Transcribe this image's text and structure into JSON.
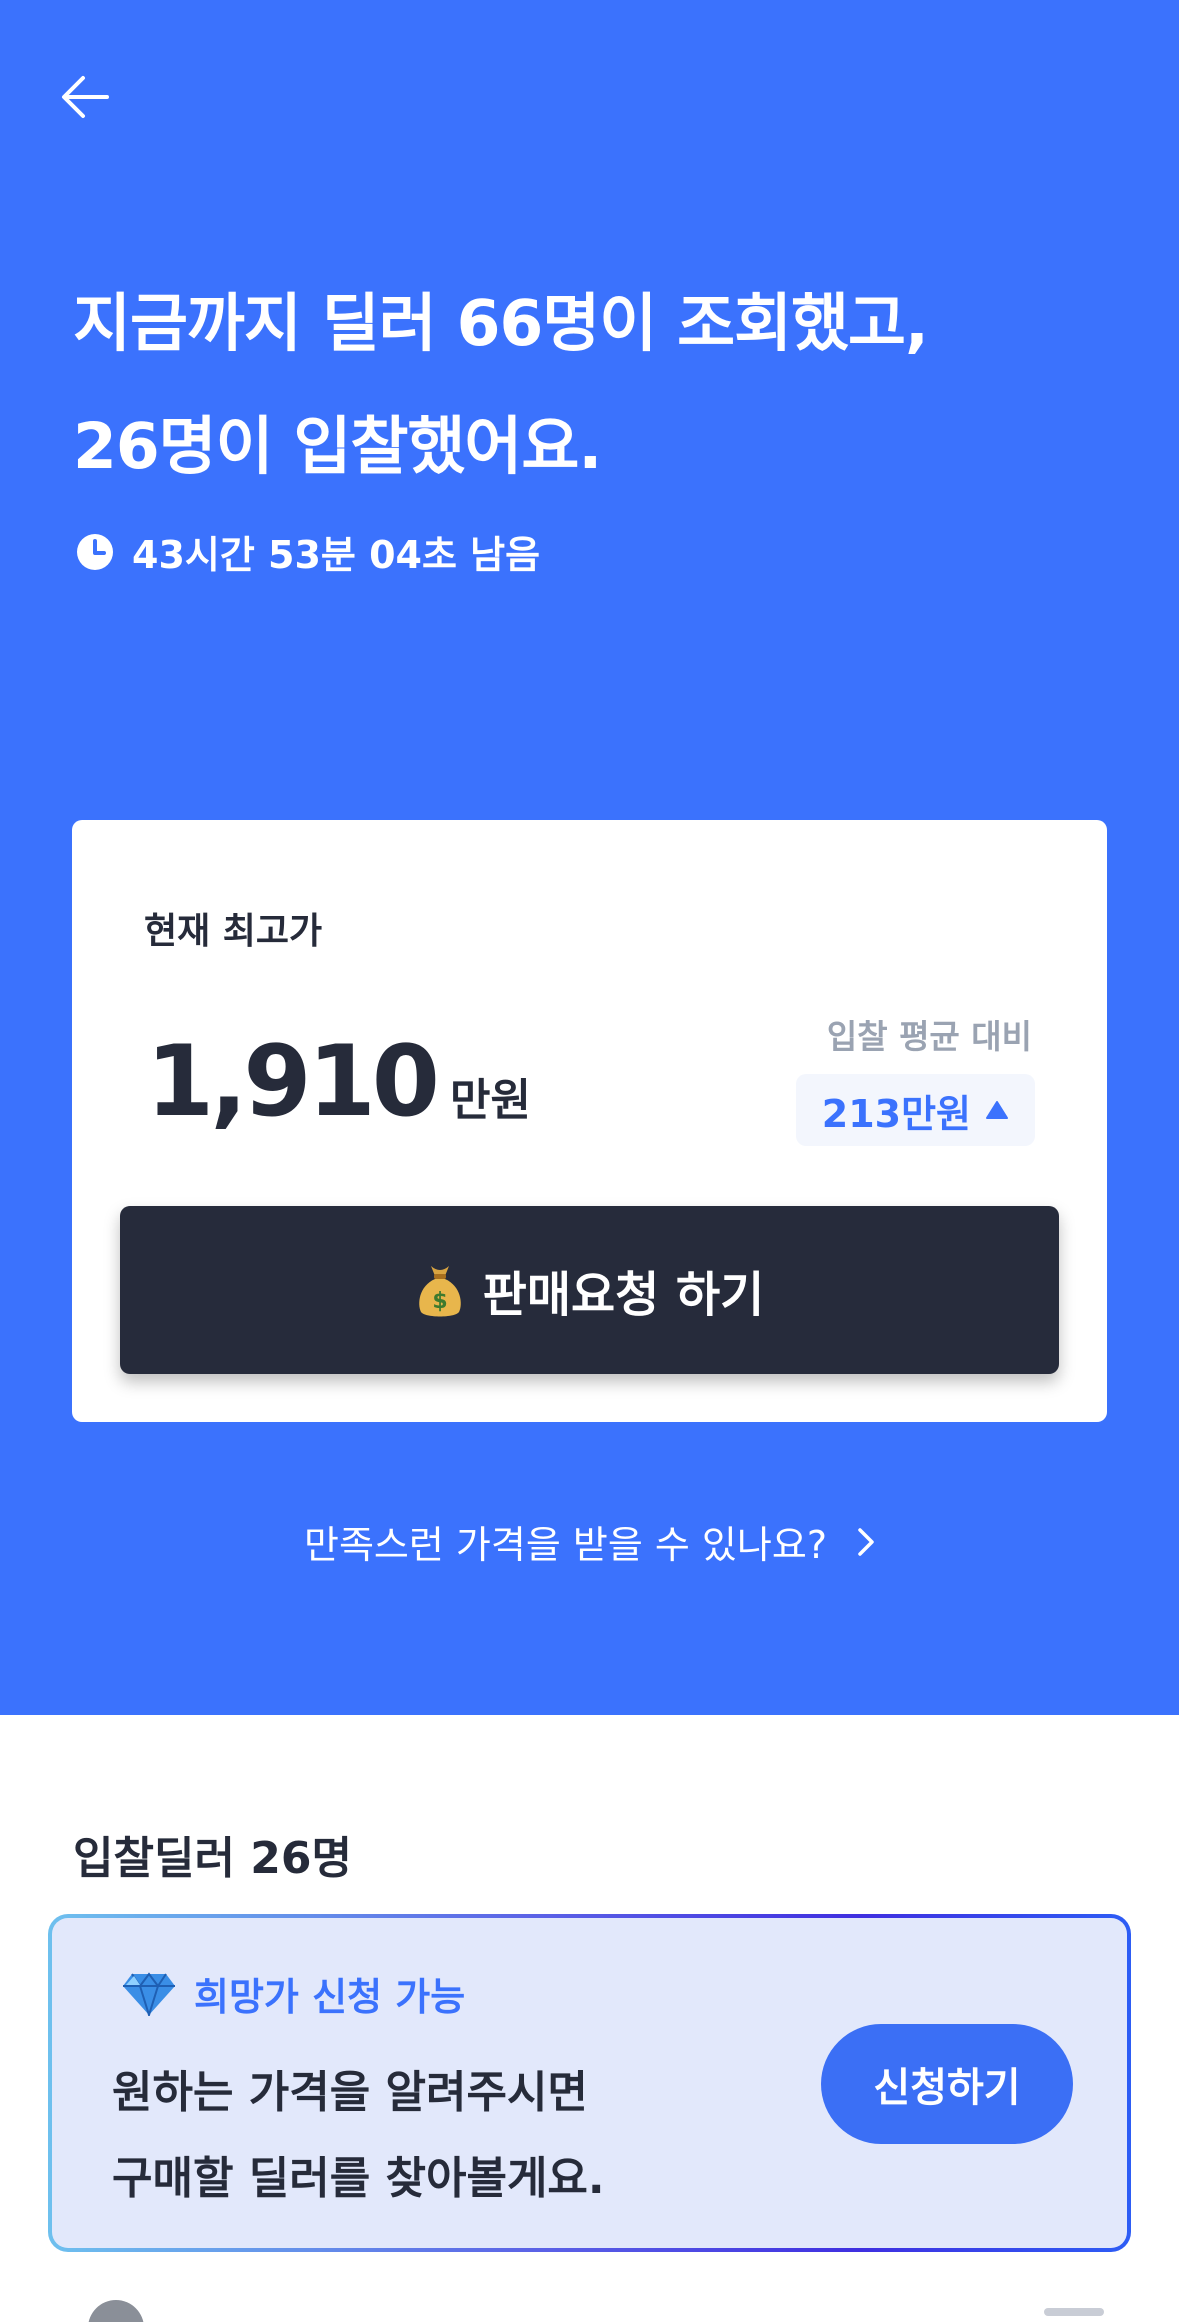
{
  "header": {
    "back_icon": "arrow-left-icon"
  },
  "hero": {
    "headline_line1": "지금까지 딜러 66명이 조회했고,",
    "headline_line2": "26명이 입찰했어요.",
    "timer_icon": "clock-icon",
    "timer_text": "43시간 53분 04초 남음",
    "bg_color": "#3b72fd"
  },
  "price_card": {
    "label": "현재 최고가",
    "price_value": "1,910",
    "price_unit": "만원",
    "avg_label": "입찰 평균 대비",
    "avg_diff": "213만원",
    "avg_trend_icon": "triangle-up-icon",
    "sell_icon": "money-bag-icon",
    "sell_label": "판매요청 하기"
  },
  "satisfy_link": {
    "label": "만족스런 가격을 받을 수 있나요?",
    "icon": "chevron-right-icon"
  },
  "bidders": {
    "title": "입찰딜러 26명"
  },
  "wish_price": {
    "tag_icon": "gem-icon",
    "tag_label": "희망가 신청 가능",
    "desc_line1": "원하는 가격을 알려주시면",
    "desc_line2": "구매할 딜러를 찾아볼게요.",
    "apply_label": "신청하기"
  },
  "colors": {
    "brand_blue": "#3b72fd",
    "dark_button": "#262b3b",
    "text_dark": "#262b3a",
    "muted": "#9aa3b2"
  }
}
